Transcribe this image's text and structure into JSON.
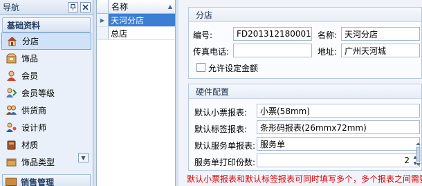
{
  "nav": {
    "title": "导航",
    "pin_icon": "pin-icon",
    "close_icon": "close-icon",
    "section_title": "基础资料",
    "items": [
      {
        "label": "分店",
        "icon": "house-icon"
      },
      {
        "label": "饰品",
        "icon": "box-icon"
      },
      {
        "label": "会员",
        "icon": "member-icon"
      },
      {
        "label": "会员等级",
        "icon": "level-icon"
      },
      {
        "label": "供货商",
        "icon": "supplier-icon"
      },
      {
        "label": "设计师",
        "icon": "designer-icon"
      },
      {
        "label": "材质",
        "icon": "material-icon"
      },
      {
        "label": "饰品类型",
        "icon": "category-icon"
      }
    ],
    "bottom_section": "销售管理"
  },
  "grid": {
    "column": "名称",
    "rows": [
      "天河分店",
      "总店"
    ],
    "selected_row": 0
  },
  "store": {
    "group_title": "分店",
    "code_label": "编号:",
    "code_value": "FD201312180001",
    "name_label": "名称:",
    "name_value": "天河分店",
    "fax_label": "传真电话:",
    "fax_value": "",
    "address_label": "地址:",
    "address_value": "广州天河城",
    "allow_amount_label": "允许设定金额",
    "allow_amount_checked": false
  },
  "hardware": {
    "group_title": "硬件配置",
    "ticket_label": "默认小票报表:",
    "ticket_value": "小票(58mm)",
    "barcode_label": "默认标签报表:",
    "barcode_value": "条形码报表(26mmx72mm)",
    "service_label": "默认服务单报表:",
    "service_value": "服务单",
    "copies_label": "服务单打印份数:",
    "copies_value": "2"
  },
  "warning_text": "默认小票报表和默认标签报表可同时填写多个，多个报表之间需要",
  "colors": {
    "selection": "#3b7ed4",
    "warning": "#e00000",
    "panel_bg": "#e9f0f9"
  }
}
